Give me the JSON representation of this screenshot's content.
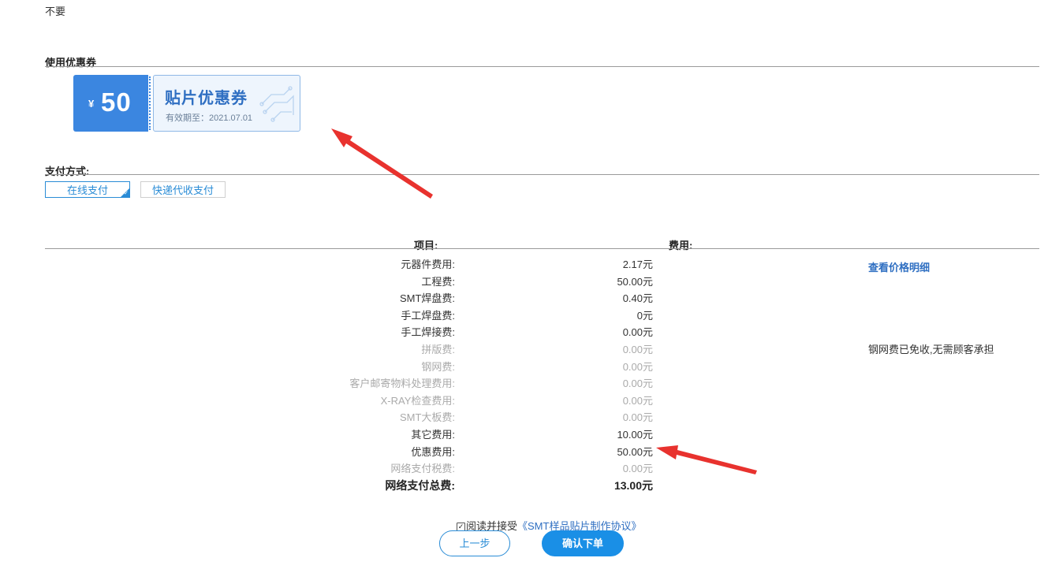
{
  "top_option": "不要",
  "coupon_section": {
    "title": "使用优惠券",
    "coupon": {
      "currency": "¥",
      "amount": "50",
      "name": "贴片优惠券",
      "expiry": "有效期至：2021.07.01"
    }
  },
  "payment": {
    "title": "支付方式:",
    "tabs": [
      {
        "label": "在线支付",
        "selected": true
      },
      {
        "label": "快递代收支付",
        "selected": false
      }
    ]
  },
  "fees": {
    "header_item": "项目:",
    "header_cost": "费用:",
    "rows": [
      {
        "label": "元器件费用:",
        "value": "2.17元",
        "muted": false
      },
      {
        "label": "工程费:",
        "value": "50.00元",
        "muted": false
      },
      {
        "label": "SMT焊盘费:",
        "value": "0.40元",
        "muted": false
      },
      {
        "label": "手工焊盘费:",
        "value": "0元",
        "muted": false
      },
      {
        "label": "手工焊接费:",
        "value": "0.00元",
        "muted": false
      },
      {
        "label": "拼版费:",
        "value": "0.00元",
        "muted": true
      },
      {
        "label": "钢网费:",
        "value": "0.00元",
        "muted": true
      },
      {
        "label": "客户邮寄物料处理费用:",
        "value": "0.00元",
        "muted": true
      },
      {
        "label": "X-RAY检查费用:",
        "value": "0.00元",
        "muted": true
      },
      {
        "label": "SMT大板费:",
        "value": "0.00元",
        "muted": true
      },
      {
        "label": "其它费用:",
        "value": "10.00元",
        "muted": false
      },
      {
        "label": "优惠费用:",
        "value": "50.00元",
        "muted": false
      },
      {
        "label": "网络支付税费:",
        "value": "0.00元",
        "muted": true
      },
      {
        "label": "网络支付总费:",
        "value": "13.00元",
        "total": true
      }
    ],
    "price_detail_link": "查看价格明细",
    "stencil_note": "钢网费已免收,无需顾客承担"
  },
  "agreement": {
    "checked": true,
    "text": "阅读并接受",
    "link": "《SMT样品贴片制作协议》"
  },
  "buttons": {
    "prev": "上一步",
    "confirm": "确认下单"
  },
  "colors": {
    "accent": "#2a8cd6",
    "coupon_blue": "#3b86e0",
    "confirm_button": "#1a8fe6",
    "annotation_arrow": "#e8322e",
    "muted_text": "#aaaaaa"
  }
}
